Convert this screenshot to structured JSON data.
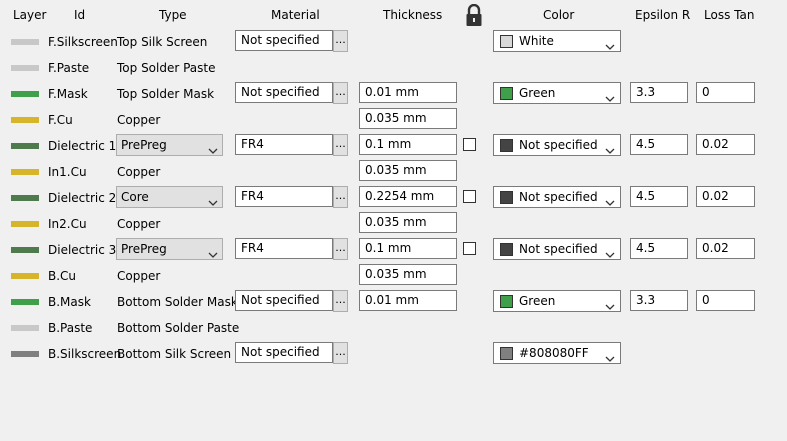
{
  "headers": {
    "layer": "Layer",
    "id": "Id",
    "type": "Type",
    "material": "Material",
    "thickness": "Thickness",
    "color": "Color",
    "epsilon_r": "Epsilon R",
    "loss_tan": "Loss Tan"
  },
  "material_button_label": "...",
  "rows": [
    {
      "swatch": "#c8c8c8",
      "id": "F.Silkscreen",
      "type": "Top Silk Screen",
      "type_kind": "text",
      "material": "Not specified",
      "thickness": "",
      "lock": false,
      "color_swatch": "#d8d8d8",
      "color": "White",
      "epsilon": "",
      "loss": ""
    },
    {
      "swatch": "#c8c8c8",
      "id": "F.Paste",
      "type": "Top Solder Paste",
      "type_kind": "text",
      "material": "",
      "thickness": "",
      "lock": false,
      "color_swatch": "",
      "color": "",
      "epsilon": "",
      "loss": ""
    },
    {
      "swatch": "#3f9f4a",
      "id": "F.Mask",
      "type": "Top Solder Mask",
      "type_kind": "text",
      "material": "Not specified",
      "thickness": "0.01 mm",
      "lock": false,
      "color_swatch": "#3f9f4a",
      "color": "Green",
      "epsilon": "3.3",
      "loss": "0"
    },
    {
      "swatch": "#d7b52a",
      "id": "F.Cu",
      "type": "Copper",
      "type_kind": "text",
      "material": "",
      "thickness": "0.035 mm",
      "lock": false,
      "color_swatch": "",
      "color": "",
      "epsilon": "",
      "loss": ""
    },
    {
      "swatch": "#4e7a4e",
      "id": "Dielectric 1",
      "type": "PrePreg",
      "type_kind": "combo",
      "material": "FR4",
      "thickness": "0.1 mm",
      "lock": true,
      "color_swatch": "#444444",
      "color": "Not specified",
      "epsilon": "4.5",
      "loss": "0.02"
    },
    {
      "swatch": "#d7b52a",
      "id": "In1.Cu",
      "type": "Copper",
      "type_kind": "text",
      "material": "",
      "thickness": "0.035 mm",
      "lock": false,
      "color_swatch": "",
      "color": "",
      "epsilon": "",
      "loss": ""
    },
    {
      "swatch": "#4e7a4e",
      "id": "Dielectric 2",
      "type": "Core",
      "type_kind": "combo",
      "material": "FR4",
      "thickness": "0.2254 mm",
      "lock": true,
      "color_swatch": "#444444",
      "color": "Not specified",
      "epsilon": "4.5",
      "loss": "0.02"
    },
    {
      "swatch": "#d7b52a",
      "id": "In2.Cu",
      "type": "Copper",
      "type_kind": "text",
      "material": "",
      "thickness": "0.035 mm",
      "lock": false,
      "color_swatch": "",
      "color": "",
      "epsilon": "",
      "loss": ""
    },
    {
      "swatch": "#4e7a4e",
      "id": "Dielectric 3",
      "type": "PrePreg",
      "type_kind": "combo",
      "material": "FR4",
      "thickness": "0.1 mm",
      "lock": true,
      "color_swatch": "#444444",
      "color": "Not specified",
      "epsilon": "4.5",
      "loss": "0.02"
    },
    {
      "swatch": "#d7b52a",
      "id": "B.Cu",
      "type": "Copper",
      "type_kind": "text",
      "material": "",
      "thickness": "0.035 mm",
      "lock": false,
      "color_swatch": "",
      "color": "",
      "epsilon": "",
      "loss": ""
    },
    {
      "swatch": "#3f9f4a",
      "id": "B.Mask",
      "type": "Bottom Solder Mask",
      "type_kind": "text",
      "material": "Not specified",
      "thickness": "0.01 mm",
      "lock": false,
      "color_swatch": "#3f9f4a",
      "color": "Green",
      "epsilon": "3.3",
      "loss": "0"
    },
    {
      "swatch": "#c8c8c8",
      "id": "B.Paste",
      "type": "Bottom Solder Paste",
      "type_kind": "text",
      "material": "",
      "thickness": "",
      "lock": false,
      "color_swatch": "",
      "color": "",
      "epsilon": "",
      "loss": ""
    },
    {
      "swatch": "#808080",
      "id": "B.Silkscreen",
      "type": "Bottom Silk Screen",
      "type_kind": "text",
      "material": "Not specified",
      "thickness": "",
      "lock": false,
      "color_swatch": "#808080",
      "color": "#808080FF",
      "epsilon": "",
      "loss": ""
    }
  ]
}
